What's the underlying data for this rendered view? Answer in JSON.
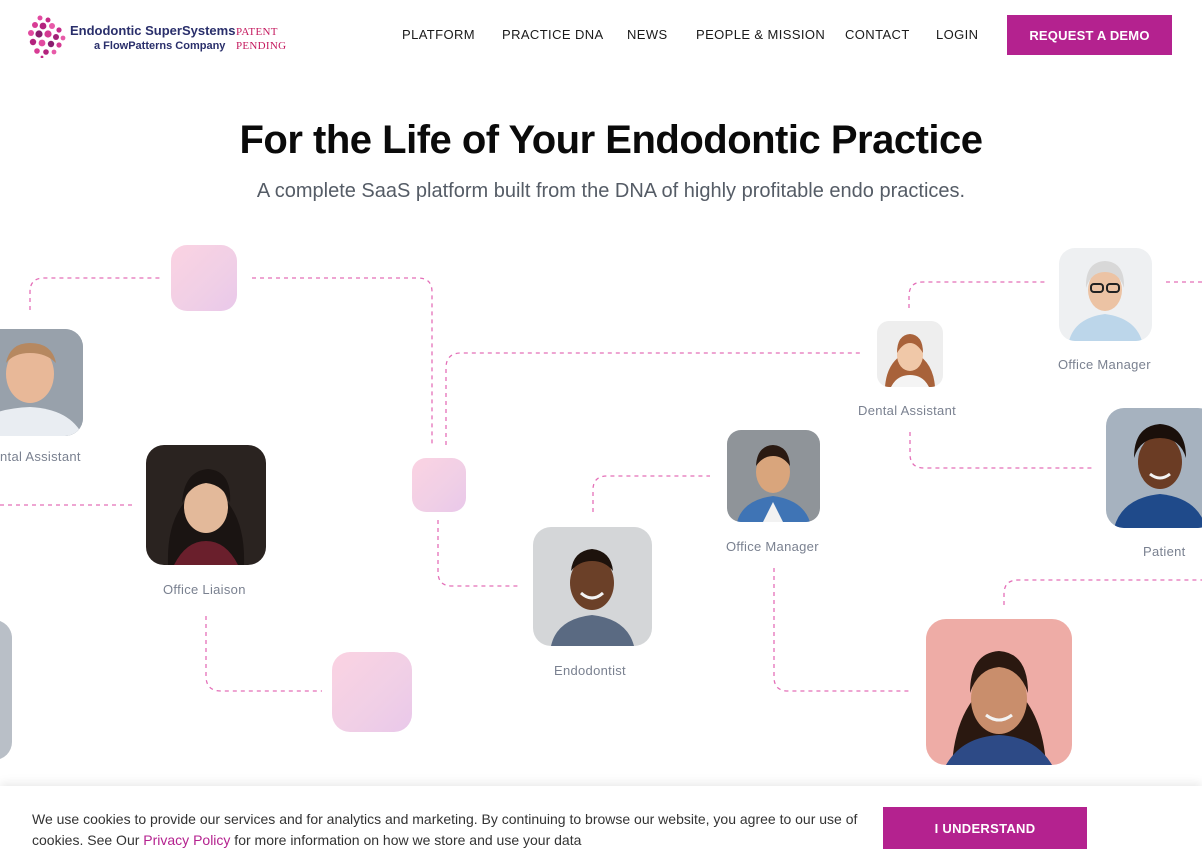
{
  "brand": {
    "name": "Endodontic SuperSystems",
    "subtitle": "a FlowPatterns Company",
    "patent_line1": "PATENT",
    "patent_line2": "PENDING"
  },
  "nav": {
    "items": [
      {
        "label": "PLATFORM"
      },
      {
        "label": "PRACTICE DNA"
      },
      {
        "label": "NEWS"
      },
      {
        "label": "PEOPLE & MISSION"
      },
      {
        "label": "CONTACT"
      },
      {
        "label": "LOGIN"
      }
    ],
    "cta_label": "REQUEST A DEMO"
  },
  "hero": {
    "title": "For the Life of Your Endodontic Practice",
    "subtitle": "A complete SaaS platform built from the DNA of highly profitable endo practices."
  },
  "network": {
    "roles": [
      {
        "label": "ntal Assistant"
      },
      {
        "label": "Office Liaison"
      },
      {
        "label": "Endodontist"
      },
      {
        "label": "Office Manager"
      },
      {
        "label": "Dental Assistant"
      },
      {
        "label": "Office Manager"
      },
      {
        "label": "Patient"
      }
    ]
  },
  "cookie": {
    "text_before": "We use cookies to provide our services and for analytics and marketing.  By continuing to browse our website, you agree to our use of cookies. See Our ",
    "link_label": "Privacy Policy",
    "text_after": " for more information on how we store and use your data",
    "button_label": "I UNDERSTAND"
  },
  "colors": {
    "accent": "#b4228f",
    "navy": "#2a2f6b",
    "patent": "#c4195e",
    "dash": "#e46fb8"
  }
}
